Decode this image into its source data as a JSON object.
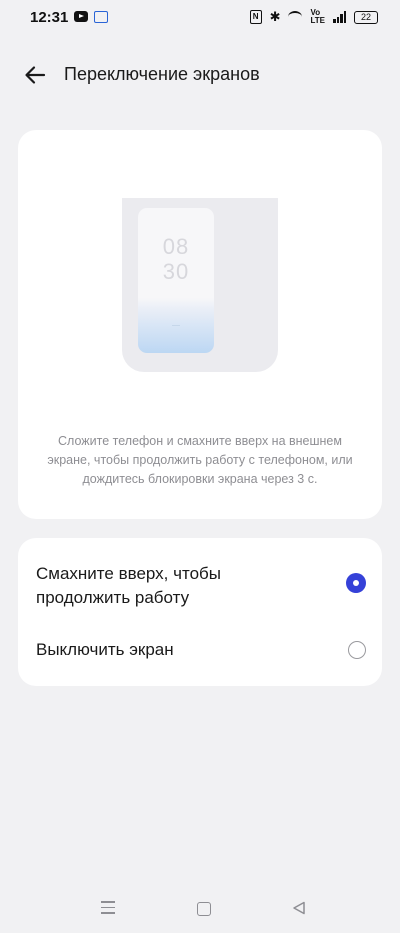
{
  "status_bar": {
    "time": "12:31",
    "battery": "22"
  },
  "header": {
    "title": "Переключение экранов"
  },
  "illustration": {
    "clock_hour": "08",
    "clock_minute": "30",
    "description": "Сложите телефон и смахните вверх на внешнем экране, чтобы продолжить работу с телефоном, или дождитесь блокировки экрана через 3 с."
  },
  "options": [
    {
      "label": "Смахните вверх, чтобы продолжить работу",
      "selected": true
    },
    {
      "label": "Выключить экран",
      "selected": false
    }
  ],
  "colors": {
    "accent": "#3541d8",
    "background": "#f1f1f3",
    "card": "#ffffff",
    "secondary_text": "#8e8e93"
  }
}
